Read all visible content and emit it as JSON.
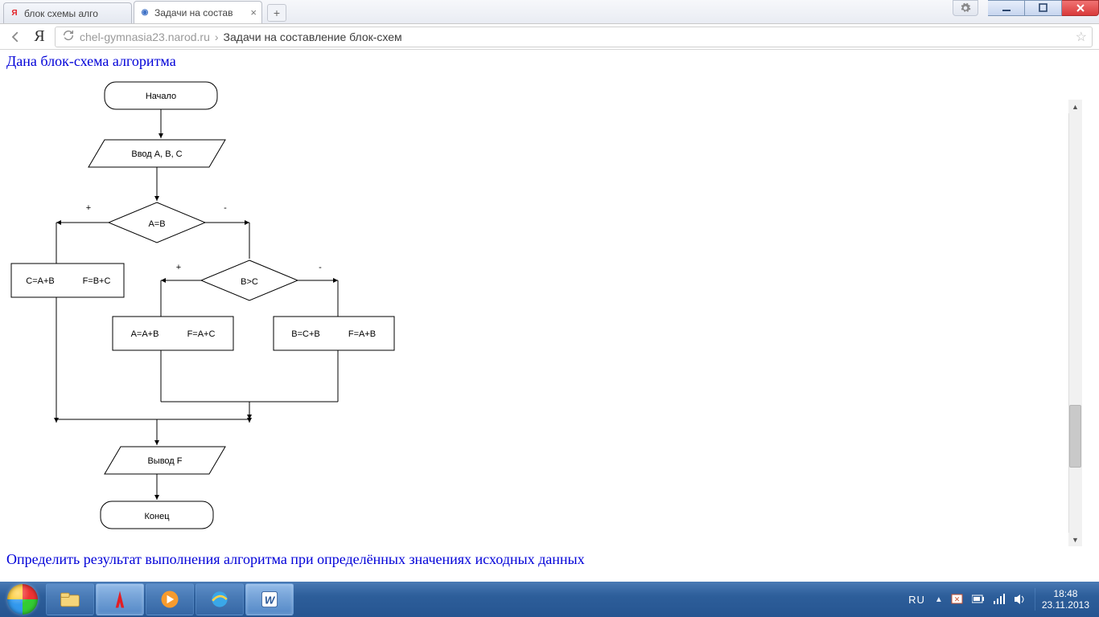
{
  "tabs": [
    {
      "title": "блок схемы алго",
      "favicon_letter": "Я",
      "favicon_color": "#e31e24"
    },
    {
      "title": "Задачи на состав",
      "favicon_letter": "◉",
      "favicon_color": "#3f72c7"
    }
  ],
  "newtab_label": "+",
  "address": {
    "reload_tooltip": "Reload",
    "domain": "chel-gymnasia23.narod.ru",
    "separator": "›",
    "title": "Задачи на составление блок-схем"
  },
  "page": {
    "heading1": "Дана блок-схема алгоритма",
    "heading2": "Определить результат выполнения алгоритма при определённых значениях исходных данных"
  },
  "flowchart": {
    "start": "Начало",
    "input": "Ввод A, B, C",
    "cond1": "A=B",
    "cond2": "B>C",
    "plus": "+",
    "minus": "-",
    "box_left_a": "C=A+B",
    "box_left_b": "F=B+C",
    "box_mid_a": "A=A+B",
    "box_mid_b": "F=A+C",
    "box_right_a": "B=C+B",
    "box_right_b": "F=A+B",
    "output": "Вывод F",
    "end": "Конец"
  },
  "taskbar": {
    "lang": "RU",
    "time": "18:48",
    "date": "23.11.2013"
  }
}
